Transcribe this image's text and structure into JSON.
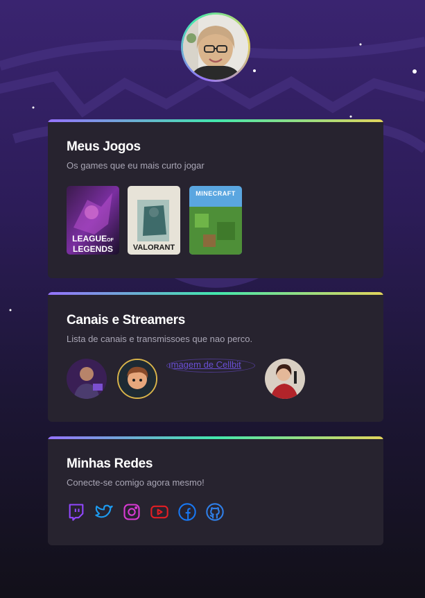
{
  "profile": {
    "avatar_alt": "Foto de perfil"
  },
  "games_card": {
    "title": "Meus Jogos",
    "subtitle": "Os games que eu mais curto jogar",
    "games": [
      {
        "name": "League of Legends",
        "line1": "LEAGUE",
        "line2": "LEGENDS",
        "small": "OF"
      },
      {
        "name": "Valorant",
        "label": "VALORANT"
      },
      {
        "name": "Minecraft",
        "label": "MINECRAFT"
      }
    ]
  },
  "streamers_card": {
    "title": "Canais e Streamers",
    "subtitle": "Lista de canais e transmissoes que nao perco.",
    "broken_image_alt": "Imagem de Cellbit"
  },
  "social_card": {
    "title": "Minhas Redes",
    "subtitle": "Conecte-se comigo agora mesmo!",
    "icons": [
      "twitch-icon",
      "twitter-icon",
      "instagram-icon",
      "youtube-icon",
      "facebook-icon",
      "github-icon"
    ],
    "colors": {
      "twitch": "#9147ff",
      "twitter": "#1d9bf0",
      "instagram": "#d93ad4",
      "youtube": "#e31e24",
      "facebook": "#1877f2",
      "github": "#2f7fe8"
    }
  }
}
